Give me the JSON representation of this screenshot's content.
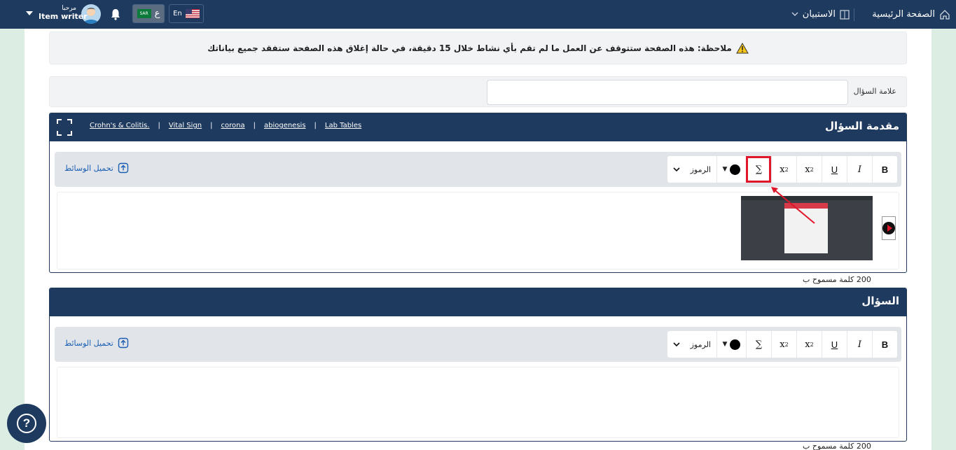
{
  "topbar": {
    "home_label": "الصفحة الرئيسية",
    "survey_label": "الاستبيان",
    "lang_en_label": "En",
    "lang_ar_label": "ع",
    "flag_sa_text": "SAR",
    "greeting": "مرحبا",
    "user_role": "Item writer"
  },
  "notice": {
    "text": "ملاحظة: هذه الصفحة ستتوقف عن العمل ما لم تقم بأي نشاط خلال 15 دقيقة، في حالة إغلاق هذه الصفحة ستفقد جميع بياناتك"
  },
  "question_mark": {
    "label": "علامة السؤال",
    "value": ""
  },
  "intro_editor": {
    "title": "مقدمة السؤال",
    "links": [
      "Lab Tables",
      "abiogenesis",
      "corona",
      "Vital Sign",
      "Crohn's & Colitis."
    ],
    "upload_label": "تحميل الوسائط",
    "symbols_label": "الرموز",
    "word_count": "200 كلمة مسموح ب"
  },
  "question_editor": {
    "title": "السؤال",
    "upload_label": "تحميل الوسائط",
    "symbols_label": "الرموز",
    "word_count": "200 كلمة مسموح ب"
  },
  "format_buttons": {
    "bold": "B",
    "italic": "I",
    "underline": "U",
    "subscript_base": "x",
    "subscript_sub": "2",
    "superscript_base": "x",
    "superscript_sup": "2",
    "sigma": "∑",
    "color_caret": "▼"
  },
  "colors": {
    "navy": "#1e3a5f",
    "highlight_red": "#e0162b",
    "link_blue": "#1a5fb4",
    "green_bg": "#dcede4"
  },
  "help": {
    "label": "?"
  }
}
